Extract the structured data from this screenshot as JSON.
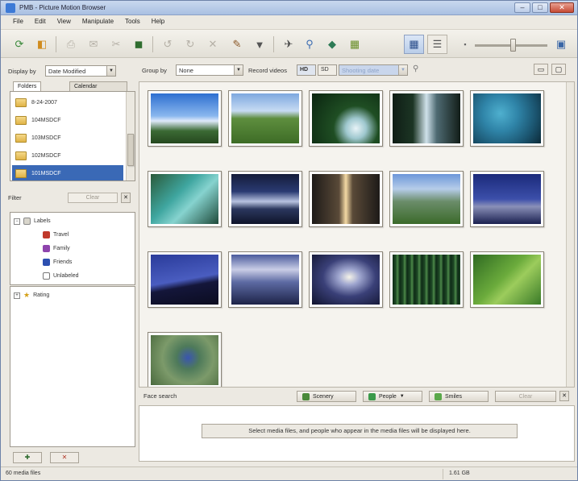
{
  "window": {
    "title": "PMB - Picture Motion Browser"
  },
  "menu": [
    "File",
    "Edit",
    "View",
    "Manipulate",
    "Tools",
    "Help"
  ],
  "left": {
    "display_by_label": "Display by",
    "display_by_value": "Date Modified",
    "tabs": [
      "Folders",
      "Calendar"
    ],
    "folders": [
      "8-24-2007",
      "104MSDCF",
      "103MSDCF",
      "102MSDCF",
      "101MSDCF"
    ],
    "filter_label": "Filter",
    "clear_label": "Clear",
    "labels_root": "Labels",
    "labels": [
      "Travel",
      "Family",
      "Friends",
      "Unlabeled"
    ],
    "label_colors": [
      "#c0392b",
      "#8e44ad",
      "#2c4fb0",
      "#ffffff"
    ],
    "rating_label": "Rating"
  },
  "content": {
    "group_by_label": "Group by",
    "group_by_value": "None",
    "record_videos_label": "Record videos",
    "record_mode_1": "HD",
    "record_mode_2": "SD",
    "record_select_value": "Shooting date"
  },
  "face": {
    "label": "Face search",
    "scenery_label": "Scenery",
    "people_label": "People",
    "smiles_label": "Smiles",
    "clear_label": "Clear",
    "message": "Select media files, and people who appear in the media files will be displayed here."
  },
  "status": {
    "count": "60 media files",
    "size": "1.61 GB"
  },
  "thumbnails": [
    "sky",
    "field",
    "waterfall-green",
    "waterfall-dark",
    "hydrangea",
    "lagoon",
    "lake-night",
    "sunset-water",
    "valley",
    "coast-blue",
    "hill-night",
    "clouds-sea",
    "sun-clouds",
    "bamboo",
    "bird-grass",
    "flower-bush"
  ]
}
